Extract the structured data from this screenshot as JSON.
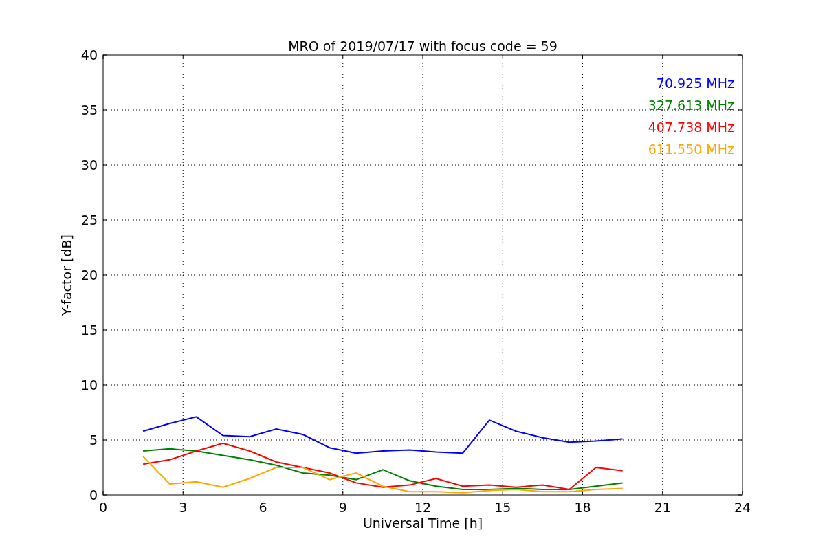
{
  "chart_data": {
    "type": "line",
    "title": "MRO of 2019/07/17 with focus code = 59",
    "xlabel": "Universal Time [h]",
    "ylabel": "Y-factor [dB]",
    "x": [
      1.5,
      2.5,
      3.5,
      4.5,
      5.5,
      6.5,
      7.5,
      8.5,
      9.5,
      10.5,
      11.5,
      12.5,
      13.5,
      14.5,
      15.5,
      16.5,
      17.5,
      18.5,
      19.5
    ],
    "series": [
      {
        "name": "70.925 MHz",
        "color": "#0000ff",
        "values": [
          5.8,
          6.5,
          7.1,
          5.4,
          5.3,
          6.0,
          5.5,
          4.3,
          3.8,
          4.0,
          4.1,
          3.9,
          3.8,
          6.8,
          5.8,
          5.2,
          4.8,
          4.9,
          5.1
        ]
      },
      {
        "name": "327.613 MHz",
        "color": "#008000",
        "values": [
          4.0,
          4.2,
          4.0,
          3.6,
          3.2,
          2.7,
          2.0,
          1.8,
          1.4,
          2.3,
          1.3,
          0.8,
          0.5,
          0.5,
          0.6,
          0.5,
          0.5,
          0.8,
          1.1
        ]
      },
      {
        "name": "407.738 MHz",
        "color": "#ff0000",
        "values": [
          2.8,
          3.2,
          4.0,
          4.7,
          4.0,
          3.0,
          2.5,
          2.0,
          1.1,
          0.7,
          0.9,
          1.5,
          0.8,
          0.9,
          0.7,
          0.9,
          0.5,
          2.5,
          2.2
        ]
      },
      {
        "name": "611.550 MHz",
        "color": "#ffa500",
        "values": [
          3.5,
          1.0,
          1.2,
          0.7,
          1.5,
          2.5,
          2.5,
          1.4,
          2.0,
          0.8,
          0.3,
          0.3,
          0.2,
          0.4,
          0.5,
          0.3,
          0.3,
          0.5,
          0.6
        ]
      }
    ],
    "grid": true,
    "xlim": [
      0,
      24
    ],
    "ylim": [
      0,
      40
    ],
    "xticks": [
      0,
      3,
      6,
      9,
      12,
      15,
      18,
      21,
      24
    ],
    "yticks": [
      0,
      5,
      10,
      15,
      20,
      25,
      30,
      35,
      40
    ]
  }
}
